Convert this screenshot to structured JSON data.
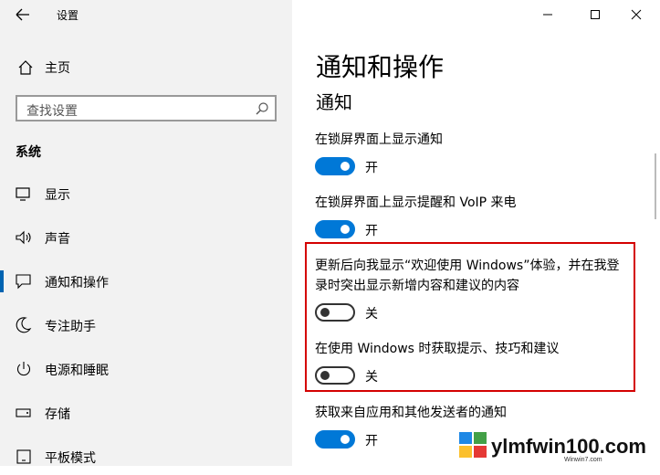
{
  "app": {
    "title": "设置"
  },
  "sidebar": {
    "home_label": "主页",
    "search_placeholder": "查找设置",
    "section": "系统",
    "items": [
      {
        "label": "显示",
        "icon": "monitor-icon"
      },
      {
        "label": "声音",
        "icon": "speaker-icon"
      },
      {
        "label": "通知和操作",
        "icon": "notification-icon",
        "active": true
      },
      {
        "label": "专注助手",
        "icon": "moon-icon"
      },
      {
        "label": "电源和睡眠",
        "icon": "power-icon"
      },
      {
        "label": "存储",
        "icon": "storage-icon"
      },
      {
        "label": "平板模式",
        "icon": "tablet-icon"
      }
    ]
  },
  "main": {
    "title": "通知和操作",
    "subtitle": "通知",
    "settings": [
      {
        "label": "在锁屏界面上显示通知",
        "state": "开",
        "on": true
      },
      {
        "label": "在锁屏界面上显示提醒和 VoIP 来电",
        "state": "开",
        "on": true
      },
      {
        "label": "更新后向我显示“欢迎使用 Windows”体验，并在我登录时突出显示新增内容和建议的内容",
        "state": "关",
        "on": false
      },
      {
        "label": "在使用 Windows 时获取提示、技巧和建议",
        "state": "关",
        "on": false
      },
      {
        "label": "获取来自应用和其他发送者的通知",
        "state": "开",
        "on": true
      }
    ]
  },
  "watermark": {
    "text": "ylmfwin100.com",
    "small": "Winwin7.com"
  },
  "colors": {
    "accent": "#0078d7",
    "highlight": "#d40000",
    "sidebar_bg": "#f2f2f2"
  }
}
